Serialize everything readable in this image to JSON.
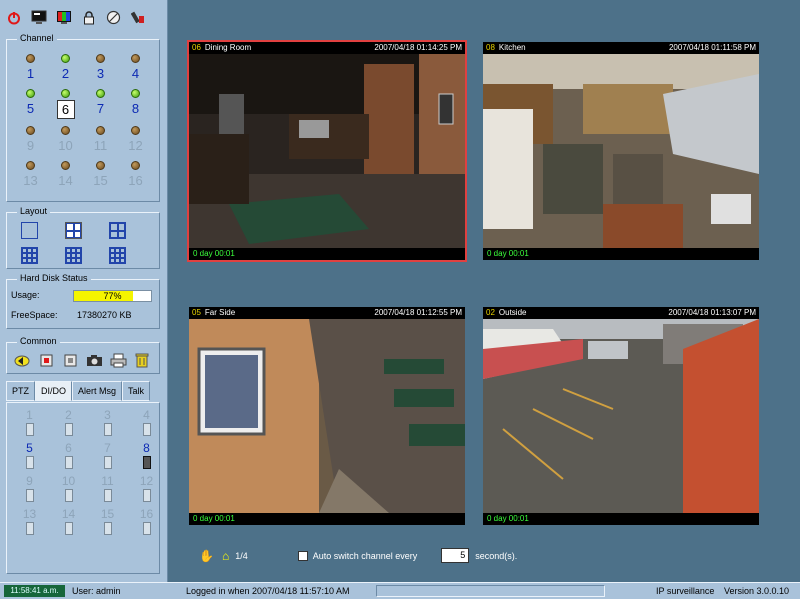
{
  "toolbar": {
    "icons": [
      "power-icon",
      "monitor-icon",
      "color-palette-icon",
      "lock-icon",
      "no-entry-icon",
      "tools-icon"
    ]
  },
  "channel": {
    "title": "Channel",
    "items": [
      {
        "num": "1",
        "on": false,
        "active": true
      },
      {
        "num": "2",
        "on": true,
        "active": true
      },
      {
        "num": "3",
        "on": false,
        "active": true
      },
      {
        "num": "4",
        "on": false,
        "active": true
      },
      {
        "num": "5",
        "on": true,
        "active": true
      },
      {
        "num": "6",
        "on": true,
        "active": true,
        "selected": true
      },
      {
        "num": "7",
        "on": true,
        "active": true
      },
      {
        "num": "8",
        "on": true,
        "active": true
      },
      {
        "num": "9",
        "on": false,
        "active": false
      },
      {
        "num": "10",
        "on": false,
        "active": false
      },
      {
        "num": "11",
        "on": false,
        "active": false
      },
      {
        "num": "12",
        "on": false,
        "active": false
      },
      {
        "num": "13",
        "on": false,
        "active": false
      },
      {
        "num": "14",
        "on": false,
        "active": false
      },
      {
        "num": "15",
        "on": false,
        "active": false
      },
      {
        "num": "16",
        "on": false,
        "active": false
      }
    ]
  },
  "layout": {
    "title": "Layout",
    "selected_index": 1,
    "options": [
      "1x1",
      "2x2",
      "1+3",
      "3x3",
      "4x4",
      "5x5"
    ]
  },
  "disk": {
    "title": "Hard Disk Status",
    "usage_label": "Usage:",
    "usage_value": "77%",
    "usage_fraction": 0.77,
    "free_label": "FreeSpace:",
    "free_value": "17380270 KB"
  },
  "common": {
    "title": "Common",
    "icons": [
      "speaker-icon",
      "record-icon",
      "stop-icon",
      "camera-icon",
      "printer-icon",
      "trash-icon"
    ]
  },
  "tabs": [
    {
      "label": "PTZ",
      "selected": false
    },
    {
      "label": "DI/DO",
      "selected": true
    },
    {
      "label": "Alert Msg",
      "selected": false
    },
    {
      "label": "Talk",
      "selected": false
    }
  ],
  "dido": [
    {
      "num": "1",
      "on": false,
      "active": false
    },
    {
      "num": "2",
      "on": false,
      "active": false
    },
    {
      "num": "3",
      "on": false,
      "active": false
    },
    {
      "num": "4",
      "on": false,
      "active": false
    },
    {
      "num": "5",
      "on": false,
      "active": true
    },
    {
      "num": "6",
      "on": false,
      "active": false
    },
    {
      "num": "7",
      "on": false,
      "active": false
    },
    {
      "num": "8",
      "on": true,
      "active": true
    },
    {
      "num": "9",
      "on": false,
      "active": false
    },
    {
      "num": "10",
      "on": false,
      "active": false
    },
    {
      "num": "11",
      "on": false,
      "active": false
    },
    {
      "num": "12",
      "on": false,
      "active": false
    },
    {
      "num": "13",
      "on": false,
      "active": false
    },
    {
      "num": "14",
      "on": false,
      "active": false
    },
    {
      "num": "15",
      "on": false,
      "active": false
    },
    {
      "num": "16",
      "on": false,
      "active": false
    }
  ],
  "cameras": [
    {
      "no": "06",
      "name": "Dining Room",
      "time": "2007/04/18 01:14:25 PM",
      "uptime": "0 day  00:01",
      "selected": true
    },
    {
      "no": "08",
      "name": "Kitchen",
      "time": "2007/04/18 01:11:58 PM",
      "uptime": "0 day  00:01",
      "selected": false
    },
    {
      "no": "05",
      "name": "Far Side",
      "time": "2007/04/18 01:12:55 PM",
      "uptime": "0 day  00:01",
      "selected": false
    },
    {
      "no": "02",
      "name": "Outside",
      "time": "2007/04/18 01:13:07 PM",
      "uptime": "0 day  00:01",
      "selected": false
    }
  ],
  "controls": {
    "page": "1/4",
    "auto_label": "Auto switch channel every",
    "seconds_value": "5",
    "seconds_label": "second(s)."
  },
  "status": {
    "clock": "11:58:41 a.m.",
    "user": "User: admin",
    "login": "Logged in when  2007/04/18 11:57:10 AM",
    "app": "IP surveillance",
    "version": "Version 3.0.0.10"
  },
  "colors": {
    "sidebar_bg": "#a9c2da",
    "main_bg": "#4d7189",
    "channel_active": "#0c29b3",
    "selected_cam_border": "#e04040",
    "led_on": "#3c9a10",
    "usage_fill": "#f5f500"
  }
}
